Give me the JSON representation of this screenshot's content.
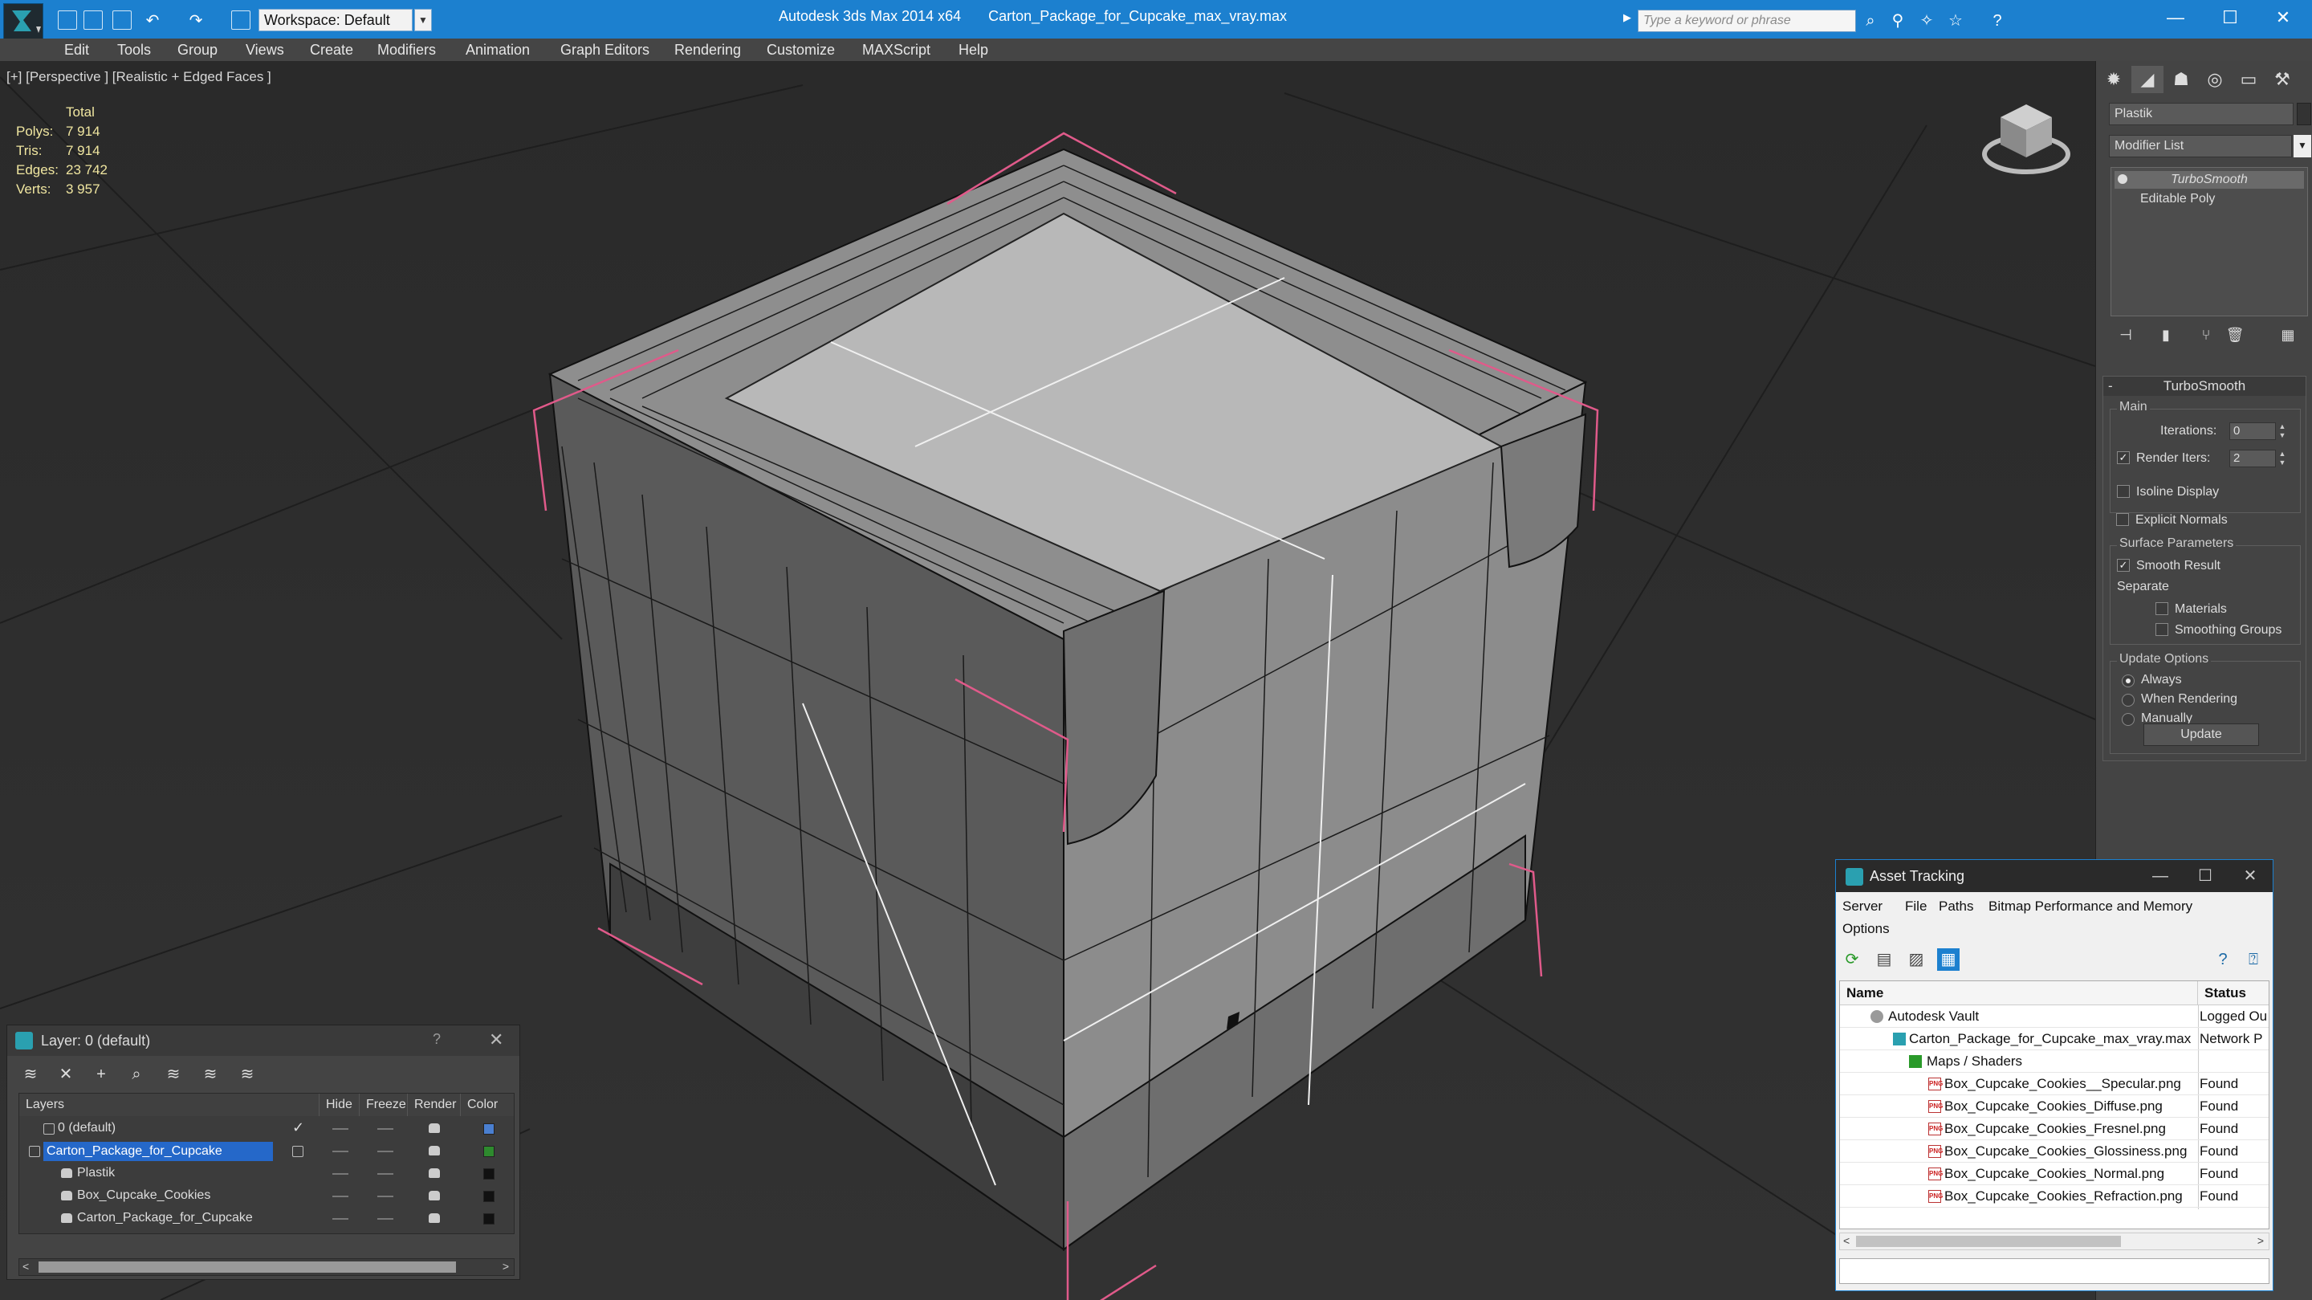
{
  "titlebar": {
    "workspace": "Workspace: Default",
    "app_title": "Autodesk 3ds Max  2014 x64",
    "file_title": "Carton_Package_for_Cupcake_max_vray.max",
    "search_placeholder": "Type a keyword or phrase",
    "help_label": "?",
    "minimize": "—",
    "maximize": "☐",
    "close": "✕"
  },
  "menubar": {
    "items": [
      "Edit",
      "Tools",
      "Group",
      "Views",
      "Create",
      "Modifiers",
      "Animation",
      "Graph Editors",
      "Rendering",
      "Customize",
      "MAXScript",
      "Help"
    ]
  },
  "viewport": {
    "label": "[+] [Perspective ] [Realistic + Edged Faces ]",
    "stats": {
      "header": "Total",
      "rows": [
        {
          "label": "Polys:",
          "value": "7 914"
        },
        {
          "label": "Tris:",
          "value": "7 914"
        },
        {
          "label": "Edges:",
          "value": "23 742"
        },
        {
          "label": "Verts:",
          "value": "3 957"
        }
      ]
    }
  },
  "command_panel": {
    "object_name": "Plastik",
    "modifier_list": "Modifier List",
    "stack": [
      "TurboSmooth",
      "Editable Poly"
    ],
    "rollout": {
      "title": "TurboSmooth",
      "main_group": "Main",
      "iterations_label": "Iterations:",
      "iterations_value": "0",
      "render_iters_label": "Render Iters:",
      "render_iters_value": "2",
      "render_iters_checked": true,
      "isoline_label": "Isoline Display",
      "explicit_label": "Explicit Normals",
      "surface_group": "Surface Parameters",
      "smooth_result_label": "Smooth Result",
      "separate_label": "Separate",
      "materials_label": "Materials",
      "smoothing_groups_label": "Smoothing Groups",
      "update_group": "Update Options",
      "always_label": "Always",
      "when_rendering_label": "When Rendering",
      "manually_label": "Manually",
      "update_button": "Update"
    }
  },
  "layer_dialog": {
    "title": "Layer: 0 (default)",
    "help": "?",
    "close": "✕",
    "columns": [
      "Layers",
      "Hide",
      "Freeze",
      "Render",
      "Color"
    ],
    "rows": [
      {
        "name": "0 (default)",
        "level": 0,
        "color": "#4a7fd0",
        "selected": false,
        "checked": true
      },
      {
        "name": "Carton_Package_for_Cupcake",
        "level": 0,
        "color": "#2e8a2e",
        "selected": true,
        "checked": false
      },
      {
        "name": "Plastik",
        "level": 1,
        "color": "#111111",
        "selected": false,
        "checked": false
      },
      {
        "name": "Box_Cupcake_Cookies",
        "level": 1,
        "color": "#111111",
        "selected": false,
        "checked": false
      },
      {
        "name": "Carton_Package_for_Cupcake",
        "level": 1,
        "color": "#111111",
        "selected": false,
        "checked": false
      }
    ]
  },
  "asset_dialog": {
    "title": "Asset Tracking",
    "menu": [
      "Server",
      "File",
      "Paths",
      "Bitmap Performance and Memory",
      "Options"
    ],
    "columns": [
      "Name",
      "Status"
    ],
    "rows": [
      {
        "name": "Autodesk Vault",
        "status": "Logged Ou",
        "indent": 1,
        "icon": "vault"
      },
      {
        "name": "Carton_Package_for_Cupcake_max_vray.max",
        "status": "Network P",
        "indent": 2,
        "icon": "max"
      },
      {
        "name": "Maps / Shaders",
        "status": "",
        "indent": 3,
        "icon": "maps"
      },
      {
        "name": "Box_Cupcake_Cookies__Specular.png",
        "status": "Found",
        "indent": 4,
        "icon": "png"
      },
      {
        "name": "Box_Cupcake_Cookies_Diffuse.png",
        "status": "Found",
        "indent": 4,
        "icon": "png"
      },
      {
        "name": "Box_Cupcake_Cookies_Fresnel.png",
        "status": "Found",
        "indent": 4,
        "icon": "png"
      },
      {
        "name": "Box_Cupcake_Cookies_Glossiness.png",
        "status": "Found",
        "indent": 4,
        "icon": "png"
      },
      {
        "name": "Box_Cupcake_Cookies_Normal.png",
        "status": "Found",
        "indent": 4,
        "icon": "png"
      },
      {
        "name": "Box_Cupcake_Cookies_Refraction.png",
        "status": "Found",
        "indent": 4,
        "icon": "png"
      }
    ]
  },
  "colors": {
    "titlebar": "#1c80cf",
    "selection": "#2568c9",
    "stats_text": "#f0e6a0",
    "box_edges": "#e05a8a"
  }
}
